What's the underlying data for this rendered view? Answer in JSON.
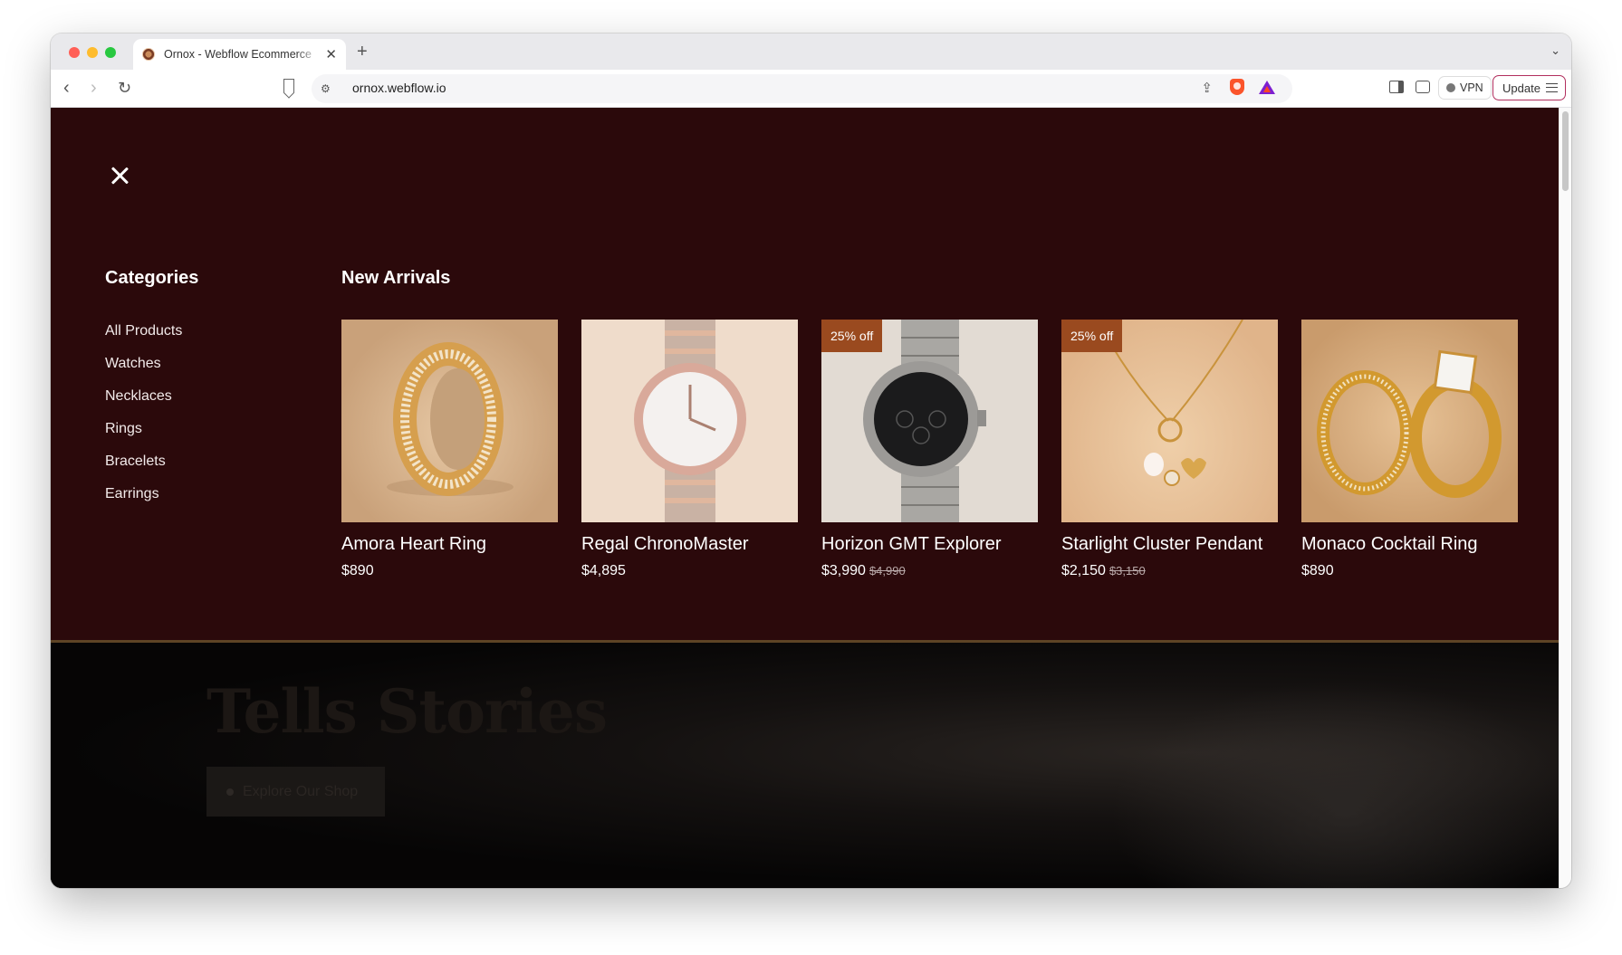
{
  "browser": {
    "tab_title": "Ornox - Webflow Ecommerce",
    "url": "ornox.webflow.io",
    "vpn_label": "VPN",
    "update_label": "Update"
  },
  "menu": {
    "categories_heading": "Categories",
    "categories": [
      "All Products",
      "Watches",
      "Necklaces",
      "Rings",
      "Bracelets",
      "Earrings"
    ],
    "arrivals_heading": "New Arrivals",
    "products": [
      {
        "name": "Amora Heart Ring",
        "price": "$890",
        "old_price": "",
        "badge": ""
      },
      {
        "name": "Regal ChronoMaster",
        "price": "$4,895",
        "old_price": "",
        "badge": ""
      },
      {
        "name": "Horizon GMT Explorer",
        "price": "$3,990",
        "old_price": "$4,990",
        "badge": "25% off"
      },
      {
        "name": "Starlight Cluster Pendant",
        "price": "$2,150",
        "old_price": "$3,150",
        "badge": "25% off"
      },
      {
        "name": "Monaco Cocktail Ring",
        "price": "$890",
        "old_price": "",
        "badge": ""
      }
    ]
  },
  "hero": {
    "title": "Tells Stories",
    "button_label": "Explore Our Shop"
  },
  "colors": {
    "menu_bg": "#2b090b",
    "badge_bg": "#9a4a1f",
    "panel_border": "#5e4425"
  }
}
